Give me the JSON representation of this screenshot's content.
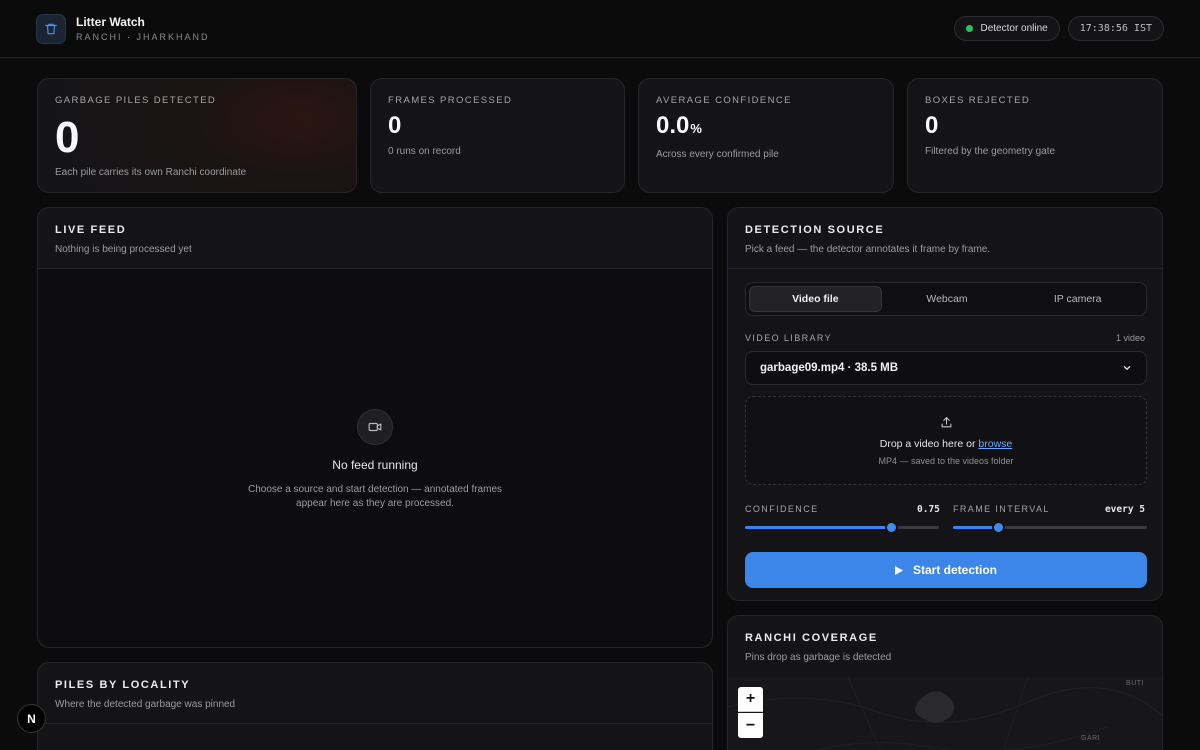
{
  "header": {
    "title": "Litter Watch",
    "subtitle": "RANCHI · JHARKHAND",
    "status": "Detector online",
    "clock": "17:38:56 IST"
  },
  "stats": [
    {
      "label": "GARBAGE PILES DETECTED",
      "value": "0",
      "note": "Each pile carries its own Ranchi coordinate"
    },
    {
      "label": "FRAMES PROCESSED",
      "value": "0",
      "note": "0 runs on record"
    },
    {
      "label": "AVERAGE CONFIDENCE",
      "value": "0.0",
      "unit": "%",
      "note": "Across every confirmed pile"
    },
    {
      "label": "BOXES REJECTED",
      "value": "0",
      "note": "Filtered by the geometry gate"
    }
  ],
  "live_feed": {
    "title": "LIVE FEED",
    "subtitle": "Nothing is being processed yet",
    "empty_title": "No feed running",
    "empty_line1": "Choose a source and start detection — annotated frames",
    "empty_line2": "appear here as they are processed."
  },
  "source": {
    "title": "DETECTION SOURCE",
    "subtitle": "Pick a feed — the detector annotates it frame by frame.",
    "tabs": [
      {
        "label": "Video file",
        "active": true
      },
      {
        "label": "Webcam",
        "active": false
      },
      {
        "label": "IP camera",
        "active": false
      }
    ],
    "library_label": "VIDEO LIBRARY",
    "library_count": "1 video",
    "selected_video": "garbage09.mp4 · 38.5 MB",
    "drop_text": "Drop a video here or",
    "drop_link": "browse",
    "drop_note": "MP4 — saved to the videos folder",
    "confidence_label": "CONFIDENCE",
    "confidence_value": "0.75",
    "confidence_fraction": 0.75,
    "interval_label": "FRAME INTERVAL",
    "interval_value": "every 5",
    "interval_fraction": 0.23,
    "start_label": "Start detection"
  },
  "coverage": {
    "title": "RANCHI COVERAGE",
    "subtitle": "Pins drop as garbage is detected",
    "map_label_1": "BUTI",
    "map_label_2": "GARI",
    "zoom_in": "+",
    "zoom_out": "−"
  },
  "locality": {
    "title": "PILES BY LOCALITY",
    "subtitle": "Where the detected garbage was pinned"
  },
  "badge": "N",
  "colors": {
    "accent": "#3b86e8",
    "online": "#22c55e",
    "link": "#6aa7ff"
  }
}
